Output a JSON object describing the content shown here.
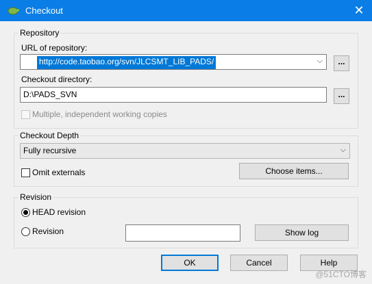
{
  "window": {
    "title": "Checkout"
  },
  "repository": {
    "legend": "Repository",
    "url_label": "URL of repository:",
    "url_value": "http://code.taobao.org/svn/JLCSMT_LIB_PADS/",
    "browse_label": "...",
    "checkout_dir_label": "Checkout directory:",
    "checkout_dir_value": "D:\\PADS_SVN",
    "dir_browse_label": "...",
    "multiple_copies_label": "Multiple, independent working copies"
  },
  "depth": {
    "legend": "Checkout Depth",
    "selected": "Fully recursive",
    "omit_externals_label": "Omit externals",
    "choose_items_label": "Choose items..."
  },
  "revision": {
    "legend": "Revision",
    "head_label": "HEAD revision",
    "revision_label": "Revision",
    "revision_value": "",
    "show_log_label": "Show log"
  },
  "buttons": {
    "ok": "OK",
    "cancel": "Cancel",
    "help": "Help"
  },
  "watermark": "@51CTO博客",
  "colors": {
    "titlebar": "#0a7ee6",
    "selection": "#0078d7",
    "dialog_bg": "#f0f0f0"
  }
}
